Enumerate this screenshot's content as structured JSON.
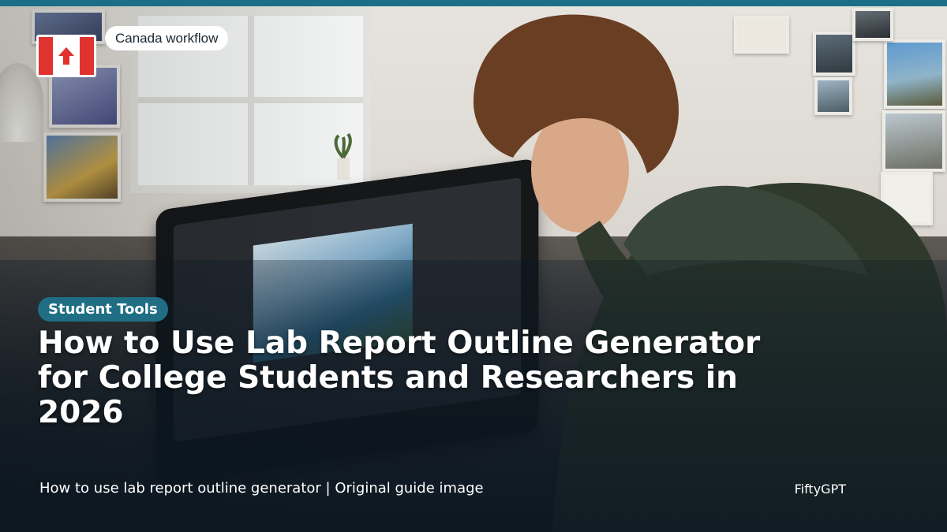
{
  "badge": {
    "label": "Canada workflow"
  },
  "flag": {
    "icon": "canada-flag-icon"
  },
  "category": {
    "label": "Student Tools"
  },
  "title": "How to Use Lab Report Outline Generator for College Students and Researchers in 2026",
  "footer": {
    "caption": "How to use lab report outline generator | Original guide image",
    "brand": "FiftyGPT"
  },
  "colors": {
    "accent": "#1f6e84",
    "top_bar": "#1a6f86",
    "flag_red": "#e0332f",
    "text": "#ffffff"
  }
}
